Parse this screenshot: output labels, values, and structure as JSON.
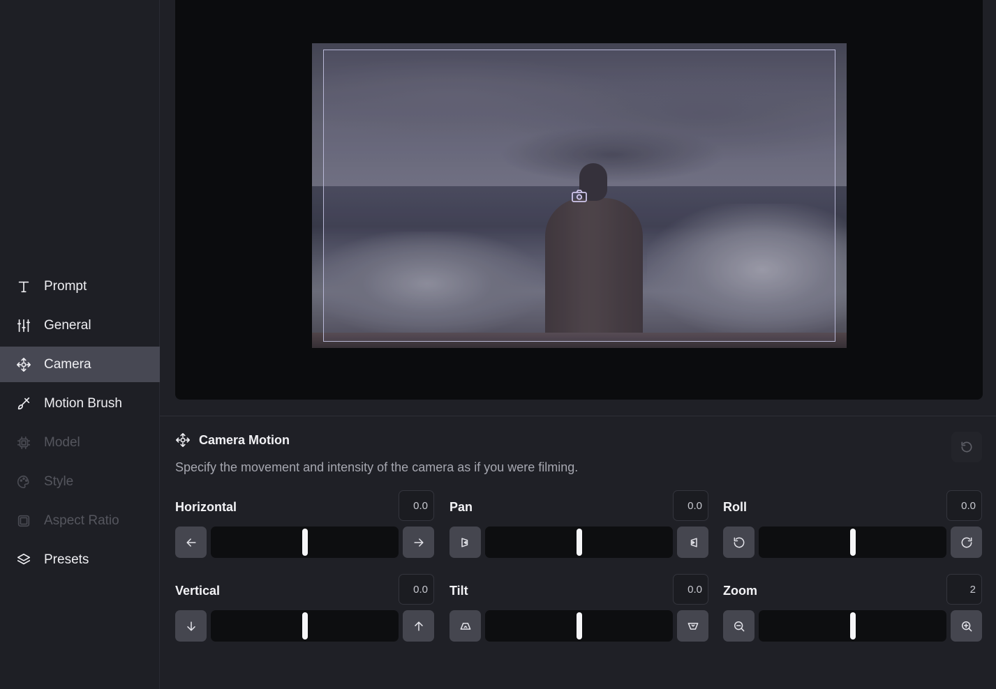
{
  "sidebar": {
    "items": [
      {
        "label": "Prompt",
        "icon": "text-t-icon",
        "state": "normal"
      },
      {
        "label": "General",
        "icon": "sliders-icon",
        "state": "normal"
      },
      {
        "label": "Camera",
        "icon": "camera-motion-icon",
        "state": "active"
      },
      {
        "label": "Motion Brush",
        "icon": "brush-icon",
        "state": "normal"
      },
      {
        "label": "Model",
        "icon": "chip-icon",
        "state": "disabled"
      },
      {
        "label": "Style",
        "icon": "palette-icon",
        "state": "disabled"
      },
      {
        "label": "Aspect Ratio",
        "icon": "aspect-ratio-icon",
        "state": "disabled"
      },
      {
        "label": "Presets",
        "icon": "layers-icon",
        "state": "normal"
      }
    ]
  },
  "panel": {
    "title": "Camera Motion",
    "description": "Specify the movement and intensity of the camera as if you were filming."
  },
  "controls": {
    "horizontal": {
      "label": "Horizontal",
      "value": "0.0",
      "level": 0.5
    },
    "pan": {
      "label": "Pan",
      "value": "0.0",
      "level": 0.5
    },
    "roll": {
      "label": "Roll",
      "value": "0.0",
      "level": 0.5
    },
    "vertical": {
      "label": "Vertical",
      "value": "0.0",
      "level": 0.5
    },
    "tilt": {
      "label": "Tilt",
      "value": "0.0",
      "level": 0.5
    },
    "zoom": {
      "label": "Zoom",
      "value": "2",
      "level": 0.5
    }
  },
  "colors": {
    "active_nav": "#474853",
    "frame_outline": "#b9b8d6",
    "slider_thumb": "#f6f6f8"
  }
}
